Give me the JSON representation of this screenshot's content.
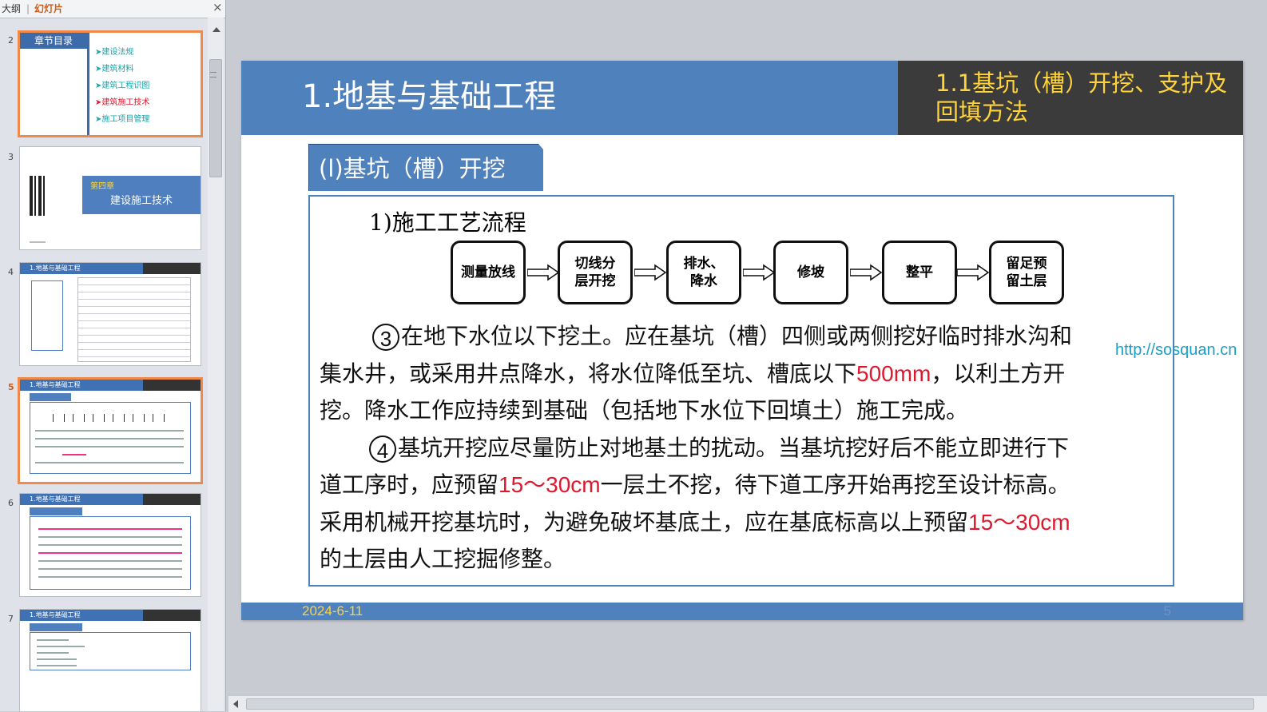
{
  "pane": {
    "tab_outline": "大纲",
    "tab_sep": "|",
    "tab_slides": "幻灯片",
    "close": "×"
  },
  "thumbs": [
    {
      "number": "2",
      "title": "章节目录",
      "items": [
        "➤建设法规",
        "➤建筑材料",
        "➤建筑工程识图",
        "➤建筑施工技术",
        "➤施工项目管理"
      ]
    },
    {
      "number": "3",
      "chapter": "第四章",
      "title": "建设施工技术"
    },
    {
      "number": "4",
      "header": "1.地基与基础工程"
    },
    {
      "number": "5",
      "header": "1.地基与基础工程"
    },
    {
      "number": "6",
      "header": "1.地基与基础工程"
    },
    {
      "number": "7",
      "header": "1.地基与基础工程"
    }
  ],
  "slide": {
    "title": "1.地基与基础工程",
    "subtitle": "1.1基坑（槽）开挖、支护及回填方法",
    "section": "(l)基坑（槽）开挖",
    "step_heading": "1)施工工艺流程",
    "steps": [
      "测量放线",
      "切线分\n层开挖",
      "排水、\n降水",
      "修坡",
      "整平",
      "留足预\n留土层"
    ],
    "para3": {
      "num": "3",
      "l1": "在地下水位以下挖土。应在基坑（槽）四侧或两侧挖好临时排水沟和",
      "l2a": "集水井，或采用井点降水，将水位降低至坑、槽底以下",
      "l2hl": "500mm",
      "l2b": "，以利土方开",
      "l3": "挖。降水工作应持续到基础（包括地下水位下回填土）施工完成。"
    },
    "para4": {
      "num": "4",
      "l1": "基坑开挖应尽量防止对地基土的扰动。当基坑挖好后不能立即进行下",
      "l2a": "道工序时，应预留",
      "l2hl": "15～30cm",
      "l2b": "一层土不挖，待下道工序开始再挖至设计标高。",
      "l3a": "采用机械开挖基坑时，为避免破坏基底土，应在基底标高以上预留",
      "l3hl": "15～30cm",
      "l4": "的土层由人工挖掘修整。"
    },
    "date": "2024-6-11",
    "page_number": "5"
  },
  "watermark": "http://sosquan.cn",
  "colors": {
    "accent_blue": "#4f81bd",
    "highlight_red": "#e0182e",
    "subtitle_yellow": "#ffd33a",
    "dark_box": "#3b3b3b"
  }
}
